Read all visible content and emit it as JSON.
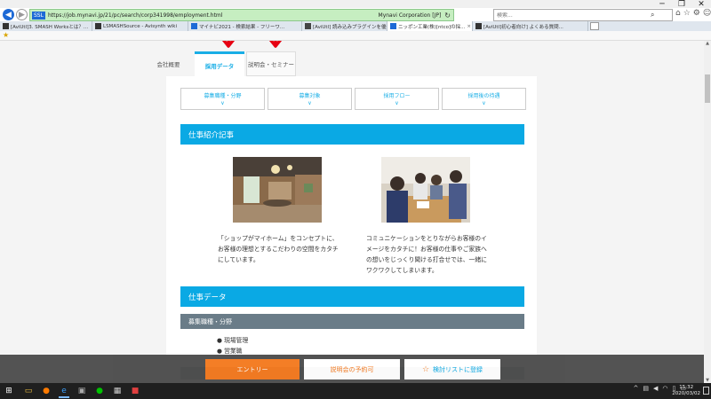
{
  "browser": {
    "url": "https://job.mynavi.jp/21/pc/search/corp341998/employment.html",
    "security_label": "Mynavi Corporation [JP]",
    "search_placeholder": "検索...",
    "ssl_badge": "SSL",
    "tabs": [
      {
        "label": "[AviUtl]3. SMASH Worksとは？...",
        "icon_color": "#333333"
      },
      {
        "label": "LSMASHSource - Avisynth wiki",
        "icon_color": "#333333"
      },
      {
        "label": "マイナビ2021 - 検索結果 - フリーワ...",
        "icon_color": "#1e6ad6"
      },
      {
        "label": "[AviUtl] 読み込みプラグインを優先...",
        "icon_color": "#444444"
      },
      {
        "label": "ニッポン工業(株)[ntco]の採...",
        "icon_color": "#1e6ad6",
        "active": true
      },
      {
        "label": "[AviUtl]初心者向け] よくある質問...",
        "icon_color": "#333333"
      }
    ]
  },
  "page": {
    "tabs": [
      {
        "label": "会社概要"
      },
      {
        "label": "採用データ"
      },
      {
        "label": "説明会・セミナー"
      }
    ],
    "subnav": [
      "募集職種・分野",
      "募集対象",
      "採用フロー",
      "採用後の待遇"
    ],
    "section_work_article": "仕事紹介記事",
    "article_left_lines": [
      "「ショップがマイホーム」をコンセプトに、",
      "お客様の理想とするこだわりの空間をカタチ",
      "にしています。"
    ],
    "article_right_lines": [
      "コミュニケーションをとりながらお客様のイ",
      "メージをカタチに！お客様の仕事やご家族へ",
      "の想いをじっくり聞ける打合せでは、一緒に",
      "ワクワクしてしまいます。"
    ],
    "section_work_data": "仕事データ",
    "subsection_jobtype": "募集職種・分野",
    "job_list": [
      "現場管理",
      "営業職"
    ]
  },
  "bottom_bar": {
    "entry": "エントリー",
    "reserve": "説明会の予約可",
    "mylist": "検討リストに登録"
  },
  "taskbar": {
    "time": "15:32",
    "date": "2020/03/02"
  },
  "colors": {
    "accent_blue": "#0aa9e4",
    "entry_orange": "#f47a20",
    "annotation_red": "#e60012"
  }
}
